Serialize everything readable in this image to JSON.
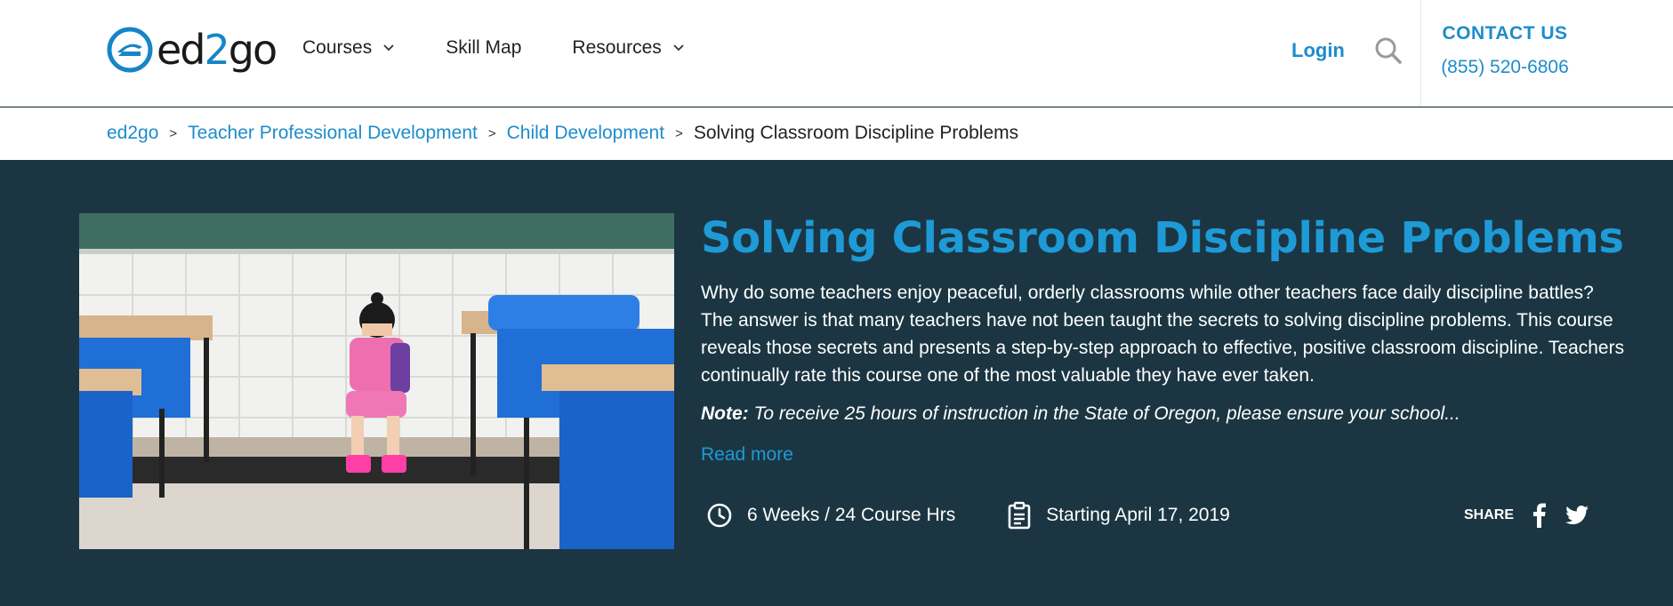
{
  "header": {
    "logo_text_a": "ed",
    "logo_text_b": "2",
    "logo_text_c": "go",
    "nav": {
      "courses": "Courses",
      "skill_map": "Skill Map",
      "resources": "Resources"
    },
    "login": "Login",
    "contact_title": "CONTACT US",
    "contact_phone": "(855) 520-6806"
  },
  "breadcrumb": {
    "items": [
      "ed2go",
      "Teacher Professional Development",
      "Child Development"
    ],
    "separator": ">",
    "current": "Solving Classroom Discipline Problems"
  },
  "course": {
    "title": "Solving Classroom Discipline Problems",
    "description": "Why do some teachers enjoy peaceful, orderly classrooms while other teachers face daily discipline battles? The answer is that many teachers have not been taught the secrets to solving discipline problems. This course reveals those secrets and presents a step-by-step approach to effective, positive classroom discipline. Teachers continually rate this course one of the most valuable they have ever taken.",
    "note_label": "Note:",
    "note_text": " To receive 25 hours of instruction in the State of Oregon, please ensure your school...",
    "read_more": "Read more",
    "duration": "6 Weeks / 24 Course Hrs",
    "start": "Starting April 17, 2019",
    "share_label": "SHARE"
  },
  "icons": {
    "courses_chevron": "chevron-down-icon",
    "resources_chevron": "chevron-down-icon",
    "search": "search-icon",
    "clock": "clock-icon",
    "clipboard": "clipboard-icon",
    "facebook": "facebook-icon",
    "twitter": "twitter-icon"
  },
  "colors": {
    "brand_blue": "#1e8ccb",
    "title_blue": "#1e9ad6",
    "hero_bg": "#1b3642"
  }
}
